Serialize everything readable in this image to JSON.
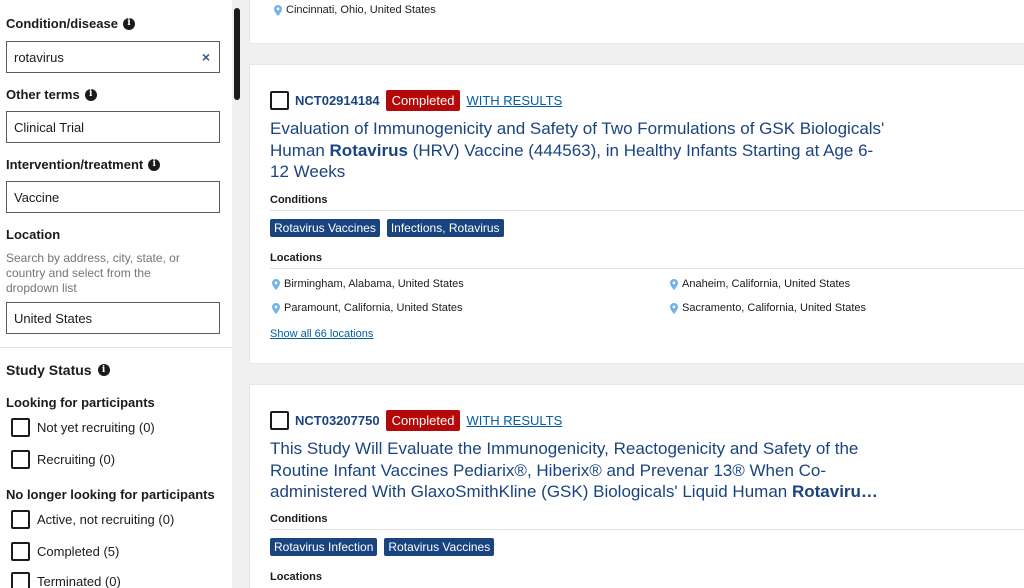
{
  "sidebar": {
    "condition": {
      "label": "Condition/disease",
      "value": "rotavirus",
      "clear": "×"
    },
    "other_terms": {
      "label": "Other terms",
      "value": "Clinical Trial"
    },
    "intervention": {
      "label": "Intervention/treatment",
      "value": "Vaccine"
    },
    "location": {
      "label": "Location",
      "hint": "Search by address, city, state, or country and select from the dropdown list",
      "value": "United States"
    },
    "study_status": {
      "title": "Study Status",
      "groups": [
        {
          "title": "Looking for participants",
          "options": [
            "Not yet recruiting (0)",
            "Recruiting (0)"
          ]
        },
        {
          "title": "No longer looking for participants",
          "options": [
            "Active, not recruiting (0)",
            "Completed (5)",
            "Terminated (0)"
          ]
        }
      ]
    }
  },
  "results": {
    "prev_location": "Cincinnati, Ohio, United States",
    "studies": [
      {
        "nct_id": "NCT02914184",
        "status": "Completed",
        "results_link": "WITH RESULTS",
        "title_before": "Evaluation of Immunogenicity and Safety of Two Formulations of GSK Biologicals' Human ",
        "title_bold": "Rotavirus",
        "title_after": " (HRV) Vaccine (444563), in Healthy Infants Starting at Age 6-12 Weeks",
        "conditions_label": "Conditions",
        "conditions": [
          "Rotavirus Vaccines",
          "Infections, Rotavirus"
        ],
        "locations_label": "Locations",
        "locations": [
          "Birmingham, Alabama, United States",
          "Anaheim, California, United States",
          "Paramount, California, United States",
          "Sacramento, California, United States"
        ],
        "show_all": "Show all 66 locations"
      },
      {
        "nct_id": "NCT03207750",
        "status": "Completed",
        "results_link": "WITH RESULTS",
        "title_before": "This Study Will Evaluate the Immunogenicity, Reactogenicity and Safety of the Routine Infant Vaccines Pediarix®, Hiberix® and Prevenar 13® When Co-administered With GlaxoSmithKline (GSK) Biologicals' Liquid Human ",
        "title_bold": "Rotaviru…",
        "title_after": "",
        "conditions_label": "Conditions",
        "conditions": [
          "Rotavirus Infection",
          "Rotavirus Vaccines"
        ],
        "locations_label": "Locations"
      }
    ]
  },
  "colors": {
    "accent": "#1a4480",
    "completed": "#b50909",
    "link": "#005ea2",
    "pin": "#73b3e7"
  }
}
